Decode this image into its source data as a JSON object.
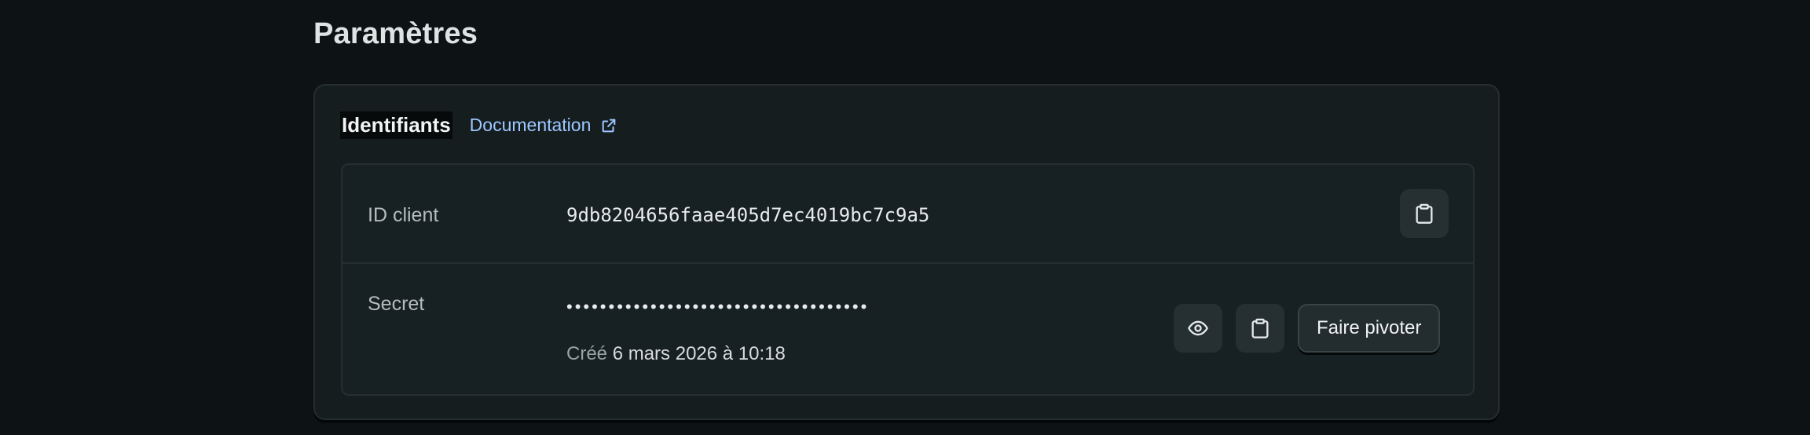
{
  "page": {
    "title": "Paramètres"
  },
  "credentials": {
    "title": "Identifiants",
    "doc_link": "Documentation",
    "client_id": {
      "label": "ID client",
      "value": "9db8204656faae405d7ec4019bc7c9a5",
      "copy_icon": "clipboard-icon"
    },
    "secret": {
      "label": "Secret",
      "masked_value": "••••••••••••••••••••••••••••••••••••",
      "created_prefix": "Créé",
      "created_date": "6 mars 2026 à 10:18",
      "reveal_icon": "eye-icon",
      "copy_icon": "clipboard-icon",
      "rotate_label": "Faire pivoter"
    }
  },
  "colors": {
    "background": "#0d1314",
    "card": "#161d1f",
    "link": "#9cc7ff",
    "muted_text": "#9aa3a6"
  }
}
